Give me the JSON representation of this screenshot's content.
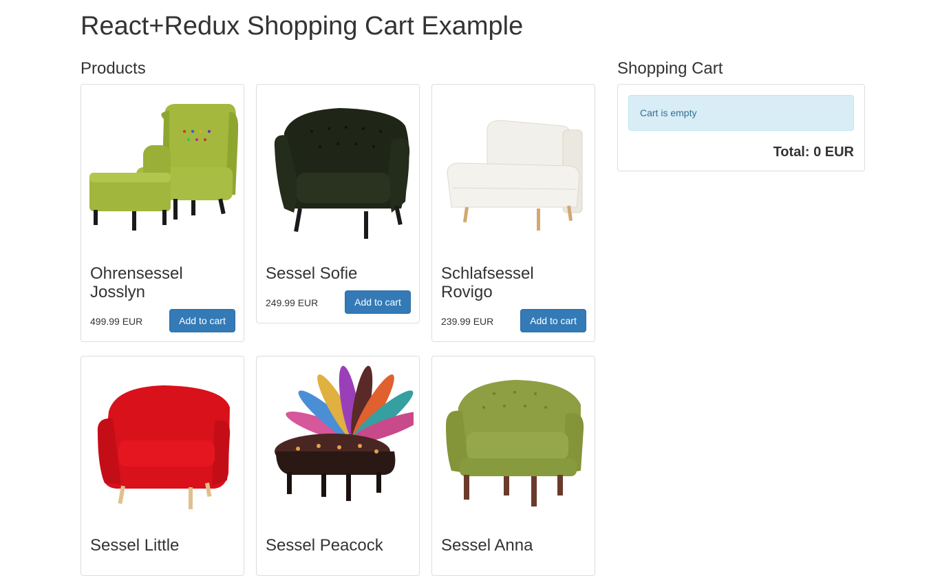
{
  "page": {
    "title": "React+Redux Shopping Cart Example"
  },
  "products_section": {
    "heading": "Products",
    "add_label": "Add to cart",
    "items": [
      {
        "name": "Ohrensessel Josslyn",
        "price": "499.99 EUR",
        "color": "#9eb43a"
      },
      {
        "name": "Sessel Sofie",
        "price": "249.99 EUR",
        "color": "#1f2617"
      },
      {
        "name": "Schlafsessel Rovigo",
        "price": "239.99 EUR",
        "color": "#f1efe9"
      },
      {
        "name": "Sessel Little",
        "color": "#d8111b"
      },
      {
        "name": "Sessel Peacock",
        "color": "#3c2a22"
      },
      {
        "name": "Sessel Anna",
        "color": "#8e9e42"
      }
    ]
  },
  "cart": {
    "heading": "Shopping Cart",
    "empty_message": "Cart is empty",
    "total": "Total: 0 EUR"
  },
  "colors": {
    "accent": "#337ab7",
    "info_bg": "#d9edf7",
    "info_text": "#31708f"
  }
}
